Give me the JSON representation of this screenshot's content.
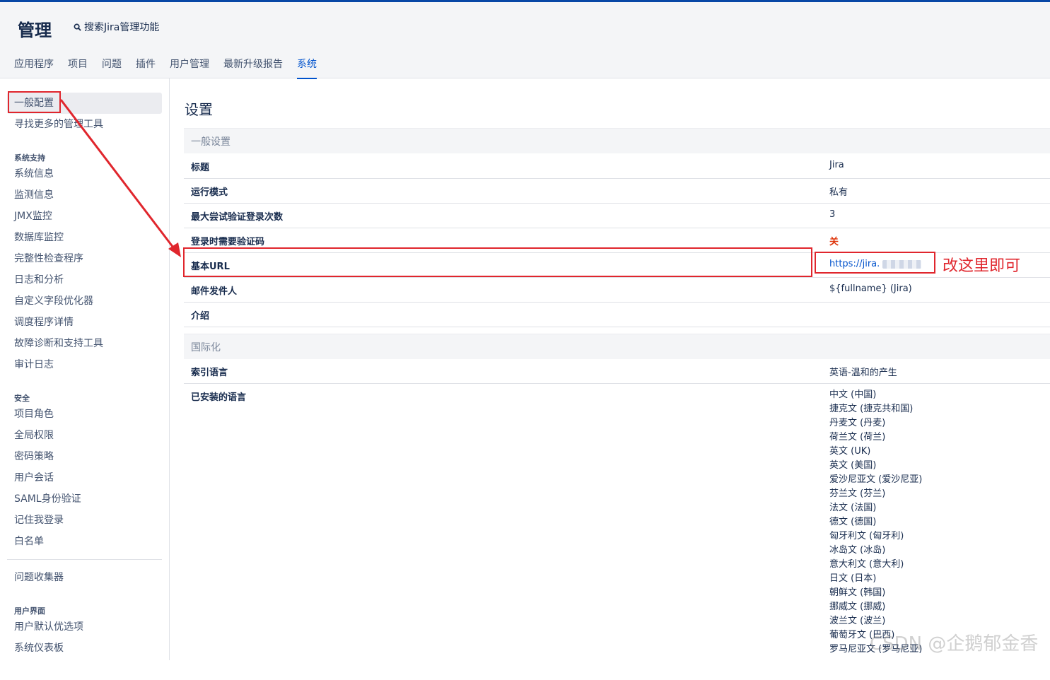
{
  "header": {
    "title": "管理",
    "search_label": "搜索Jira管理功能",
    "tabs": [
      "应用程序",
      "项目",
      "问题",
      "插件",
      "用户管理",
      "最新升级报告",
      "系统"
    ],
    "active_tab": "系统"
  },
  "sidebar": {
    "top_items": [
      "一般配置",
      "寻找更多的管理工具"
    ],
    "sections": [
      {
        "heading": "系统支持",
        "items": [
          "系统信息",
          "监测信息",
          "JMX监控",
          "数据库监控",
          "完整性检查程序",
          "日志和分析",
          "自定义字段优化器",
          "调度程序详情",
          "故障诊断和支持工具",
          "审计日志"
        ]
      },
      {
        "heading": "安全",
        "items": [
          "项目角色",
          "全局权限",
          "密码策略",
          "用户会话",
          "SAML身份验证",
          "记住我登录",
          "白名单"
        ]
      },
      {
        "heading": "",
        "items": [
          "问题收集器"
        ]
      },
      {
        "heading": "用户界面",
        "items": [
          "用户默认优选项",
          "系统仪表板"
        ]
      }
    ]
  },
  "main": {
    "page_title": "设置",
    "general": {
      "heading": "一般设置",
      "rows": [
        {
          "key": "标题",
          "value": "Jira"
        },
        {
          "key": "运行模式",
          "value": "私有"
        },
        {
          "key": "最大尝试验证登录次数",
          "value": "3"
        },
        {
          "key": "登录时需要验证码",
          "value": "关"
        },
        {
          "key": "基本URL",
          "value": "https://jira."
        },
        {
          "key": "邮件发件人",
          "value": "${fullname} (Jira)"
        },
        {
          "key": "介绍",
          "value": ""
        }
      ]
    },
    "i18n": {
      "heading": "国际化",
      "index_language_key": "索引语言",
      "index_language_value": "英语-温和的产生",
      "installed_key": "已安装的语言",
      "installed": [
        "中文 (中国)",
        "捷克文 (捷克共和国)",
        "丹麦文 (丹麦)",
        "荷兰文 (荷兰)",
        "英文 (UK)",
        "英文 (美国)",
        "爱沙尼亚文 (爱沙尼亚)",
        "芬兰文 (芬兰)",
        "法文 (法国)",
        "德文 (德国)",
        "匈牙利文 (匈牙利)",
        "冰岛文 (冰岛)",
        "意大利文 (意大利)",
        "日文 (日本)",
        "朝鲜文 (韩国)",
        "挪威文 (挪威)",
        "波兰文 (波兰)",
        "葡萄牙文 (巴西)",
        "罗马尼亚文 (罗马尼亚)"
      ]
    }
  },
  "annotation": {
    "text": "改这里即可",
    "color": "#e0262d"
  },
  "watermark": "CSDN @企鹅郁金香",
  "colors": {
    "accent": "#0052cc",
    "top_bar": "#0747a6",
    "warning_red": "#de350b"
  }
}
